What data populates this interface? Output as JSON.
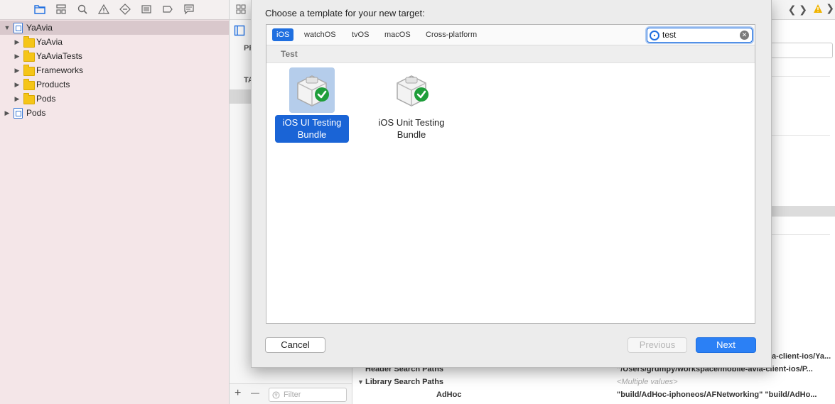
{
  "navigator": {
    "items": [
      {
        "label": "YaAvia",
        "expanded": true,
        "type": "project",
        "level": 0
      },
      {
        "label": "YaAvia",
        "expanded": false,
        "type": "folder",
        "level": 1
      },
      {
        "label": "YaAviaTests",
        "expanded": false,
        "type": "folder",
        "level": 1
      },
      {
        "label": "Frameworks",
        "expanded": false,
        "type": "folder",
        "level": 1
      },
      {
        "label": "Products",
        "expanded": false,
        "type": "folder",
        "level": 1
      },
      {
        "label": "Pods",
        "expanded": false,
        "type": "folder",
        "level": 1
      },
      {
        "label": "Pods",
        "expanded": false,
        "type": "project",
        "level": 0
      }
    ]
  },
  "editor_strip": {
    "label_pr": "PR",
    "label_ta": "TA",
    "add_symbol": "+",
    "remove_symbol": "—",
    "filter_placeholder": "Filter"
  },
  "settings": {
    "rows": [
      {
        "name": "",
        "value": "a-client-ios/Ya..."
      },
      {
        "name": "Header Search Paths",
        "value": "\"/Users/grumpy/workspace/mobile-avia-client-ios/P..."
      },
      {
        "name": "Library Search Paths",
        "value": "<Multiple values>",
        "muted": true,
        "expanded": true
      },
      {
        "name": "AdHoc",
        "value": "\"build/AdHoc-iphoneos/AFNetworking\" \"build/AdHo..."
      }
    ]
  },
  "sheet": {
    "title": "Choose a template for your new target:",
    "tabs": [
      "iOS",
      "watchOS",
      "tvOS",
      "macOS",
      "Cross-platform"
    ],
    "active_tab": "iOS",
    "search_value": "test",
    "section_label": "Test",
    "templates": [
      {
        "label": "iOS UI Testing Bundle",
        "selected": true
      },
      {
        "label": "iOS Unit Testing Bundle",
        "selected": false
      }
    ],
    "cancel_label": "Cancel",
    "previous_label": "Previous",
    "next_label": "Next"
  },
  "colors": {
    "accent": "#1f6fe0",
    "next_button": "#2b80f5",
    "selection": "#1a64d6",
    "checkmark": "#1e9e3a"
  }
}
